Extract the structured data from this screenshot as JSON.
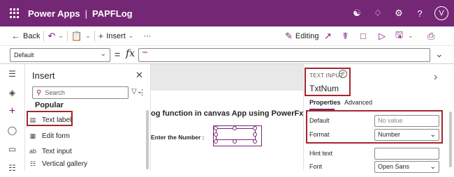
{
  "topbar": {
    "app_name": "Power Apps",
    "separator": "|",
    "doc_name": "PAPFLog",
    "avatar_initial": "V",
    "icons": [
      "copilot-icon",
      "bell-icon",
      "gear-icon",
      "help-icon"
    ]
  },
  "command_bar": {
    "back_label": "Back",
    "insert_label": "Insert",
    "more_label": "···",
    "editing_label": "Editing"
  },
  "formula_bar": {
    "property": "Default",
    "eq": "=",
    "fx": "fx",
    "formula": "\"\""
  },
  "insert_pane": {
    "title": "Insert",
    "search_placeholder": "Search",
    "section": "Popular",
    "items": [
      {
        "label": "Text label",
        "icon": "text-label-icon"
      },
      {
        "label": "Edit form",
        "icon": "edit-form-icon"
      },
      {
        "label": "Text input",
        "icon": "text-input-icon"
      },
      {
        "label": "Vertical gallery",
        "icon": "gallery-icon"
      }
    ]
  },
  "canvas": {
    "heading": "og function in canvas App using PowerFx",
    "enter_label": "Enter the Number :"
  },
  "properties": {
    "control_type": "TEXT INPUT",
    "control_name": "TxtNum",
    "tabs": [
      "Properties",
      "Advanced"
    ],
    "rows": [
      {
        "label": "Default",
        "value": "No value",
        "placeholder": true
      },
      {
        "label": "Format",
        "value": "Number",
        "dropdown": true
      },
      {
        "label": "Hint text",
        "value": "",
        "placeholder": false
      },
      {
        "label": "Font",
        "value": "Open Sans",
        "dropdown": true
      }
    ]
  },
  "colors": {
    "brand": "#742774",
    "highlight": "#a4262c"
  }
}
